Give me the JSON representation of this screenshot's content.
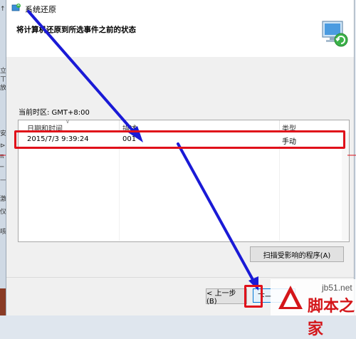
{
  "background": {
    "left_glyphs": [
      "↑",
      "立",
      "ㄒ",
      "放",
      "安",
      "⊳",
      "π",
      "─",
      "—",
      "激",
      "仪",
      "咳"
    ]
  },
  "window": {
    "title": "系统还原",
    "heading": "将计算机还原到所选事件之前的状态",
    "timezone": "当前时区: GMT+8:00"
  },
  "table": {
    "columns": [
      "日期和时间",
      "描述",
      "类型"
    ],
    "rows": [
      {
        "date": "2015/7/3 9:39:24",
        "description": "001",
        "type": "手动"
      }
    ]
  },
  "buttons": {
    "scan": "扫描受影响的程序(A)",
    "back": "< 上一步(B)",
    "next": "下一"
  },
  "watermark": {
    "site": "jb51.net",
    "text": "脚本之家"
  },
  "colors": {
    "highlight": "#e0101a",
    "arrow": "#1a1ad6",
    "selection_accent": "#0078d7"
  }
}
